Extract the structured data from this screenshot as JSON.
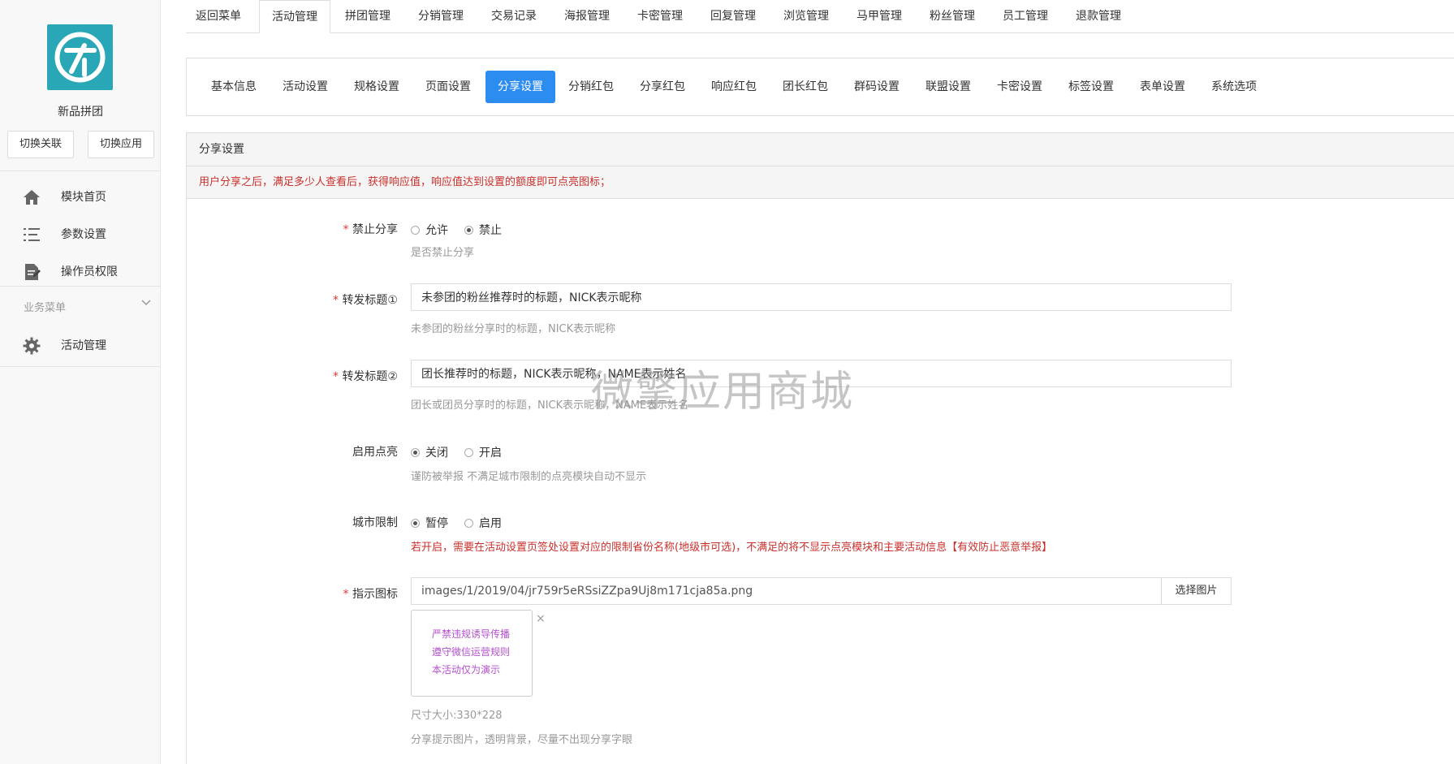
{
  "app": {
    "name": "新品拼团",
    "switch_buttons": [
      "切换关联",
      "切换应用"
    ]
  },
  "sidebar": {
    "items": [
      {
        "label": "模块首页",
        "icon": "home-icon"
      },
      {
        "label": "参数设置",
        "icon": "list-icon"
      },
      {
        "label": "操作员权限",
        "icon": "document-edit-icon"
      }
    ],
    "group_title": "业务菜单",
    "group_items": [
      {
        "label": "活动管理",
        "icon": "gear-icon"
      }
    ]
  },
  "top_tabs": {
    "items": [
      "返回菜单",
      "活动管理",
      "拼团管理",
      "分销管理",
      "交易记录",
      "海报管理",
      "卡密管理",
      "回复管理",
      "浏览管理",
      "马甲管理",
      "粉丝管理",
      "员工管理",
      "退款管理"
    ],
    "active": "活动管理"
  },
  "sub_tabs": {
    "items": [
      "基本信息",
      "活动设置",
      "规格设置",
      "页面设置",
      "分享设置",
      "分销红包",
      "分享红包",
      "响应红包",
      "团长红包",
      "群码设置",
      "联盟设置",
      "卡密设置",
      "标签设置",
      "表单设置",
      "系统选项"
    ],
    "active": "分享设置"
  },
  "panel": {
    "title": "分享设置",
    "notice": "用户分享之后，满足多少人查看后，获得响应值，响应值达到设置的额度即可点亮图标；"
  },
  "form": {
    "disable_share": {
      "required_mark": "*",
      "label": "禁止分享",
      "options": [
        "允许",
        "禁止"
      ],
      "selected": "禁止",
      "help": "是否禁止分享"
    },
    "title1": {
      "required_mark": "*",
      "label": "转发标题①",
      "value": "未参团的粉丝推荐时的标题，NICK表示昵称",
      "help": "未参团的粉丝分享时的标题，NICK表示昵称"
    },
    "title2": {
      "required_mark": "*",
      "label": "转发标题②",
      "value": "团长推荐时的标题，NICK表示昵称，NAME表示姓名",
      "help": "团长或团员分享时的标题，NICK表示昵称，NAME表示姓名"
    },
    "light_up": {
      "label": "启用点亮",
      "options": [
        "关闭",
        "开启"
      ],
      "selected": "关闭",
      "help": "谨防被举报 不满足城市限制的点亮模块自动不显示"
    },
    "city_limit": {
      "label": "城市限制",
      "options": [
        "暂停",
        "启用"
      ],
      "selected": "暂停",
      "help": "若开启，需要在活动设置页签处设置对应的限制省份名称(地级市可选)，不满足的将不显示点亮模块和主要活动信息【有效防止恶意举报】"
    },
    "indicator_icon": {
      "required_mark": "*",
      "label": "指示图标",
      "value": "images/1/2019/04/jr759r5eRSsiZZpa9Uj8m171cja85a.png",
      "button": "选择图片",
      "close": "×",
      "preview_lines": [
        "严禁违规诱导传播",
        "遵守微信运营规则",
        "本活动仅为演示"
      ],
      "size_hint": "尺寸大小:330*228",
      "help": "分享提示图片，透明背景，尽量不出现分享字眼"
    }
  },
  "watermark": "微擎应用商城",
  "colors": {
    "primary": "#2d8cf0",
    "danger_text": "#c9302c",
    "logo_bg": "#2aa7b7",
    "preview_text": "#b54fd1"
  }
}
